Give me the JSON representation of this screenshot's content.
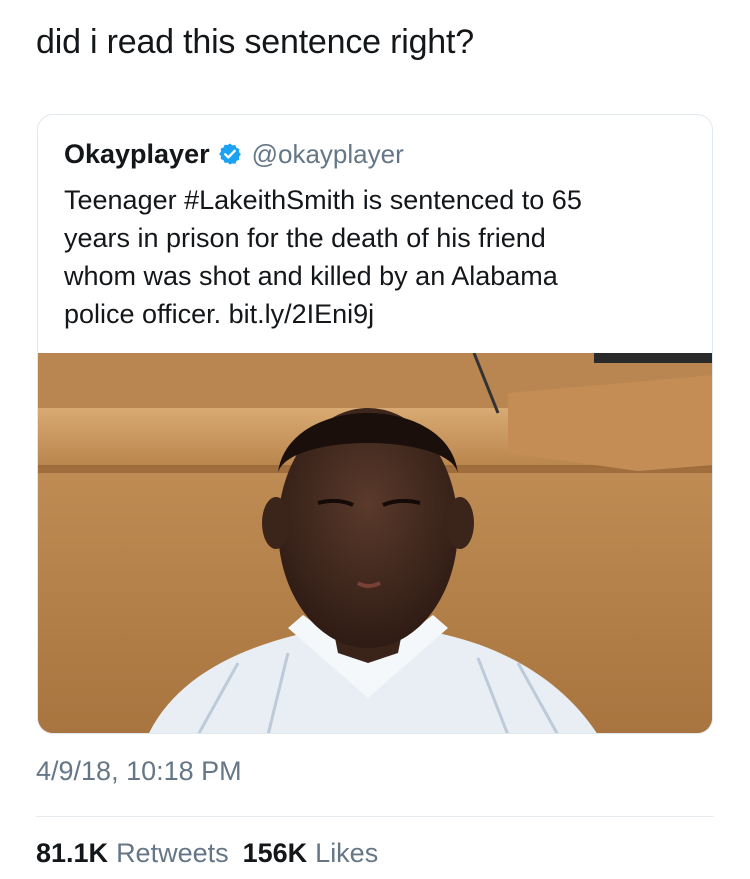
{
  "post": {
    "text": "did i read this sentence right?"
  },
  "quoted_tweet": {
    "display_name": "Okayplayer",
    "handle": "@okayplayer",
    "verified_icon": "verified-badge-icon",
    "text_lines": [
      "Teenager #LakeithSmith is sentenced to 65",
      "years in prison for the death of his friend",
      "whom was shot and killed by an Alabama",
      "police officer. bit.ly/2IEni9j"
    ],
    "media": "photo-young-man-in-courtroom"
  },
  "timestamp": "4/9/18, 10:18 PM",
  "stats": {
    "retweets_count": "81.1K",
    "retweets_label": "Retweets",
    "likes_count": "156K",
    "likes_label": "Likes"
  },
  "colors": {
    "text_primary": "#14171a",
    "text_secondary": "#657786",
    "verified_blue": "#1da1f2",
    "border": "#e1e8ed"
  }
}
